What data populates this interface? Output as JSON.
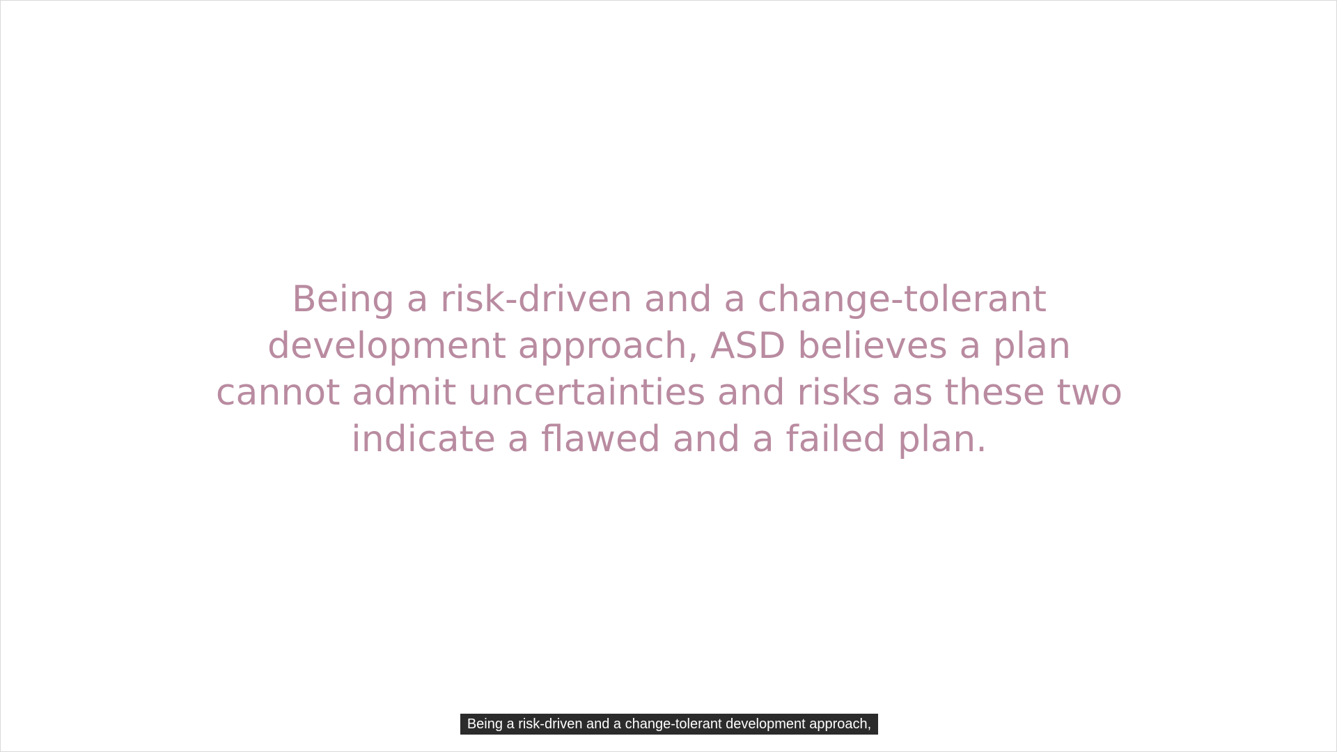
{
  "slide": {
    "lines": [
      "Being a risk-driven and a change-tolerant",
      "development approach, ASD believes a plan",
      "cannot admit uncertainties and risks as these two",
      "indicate a flawed and a failed plan."
    ],
    "text_color": "#b98ba0"
  },
  "subtitle": {
    "text": "Being a risk-driven and a change-tolerant development approach,",
    "background": "#2b2b2b",
    "color": "#ffffff"
  }
}
